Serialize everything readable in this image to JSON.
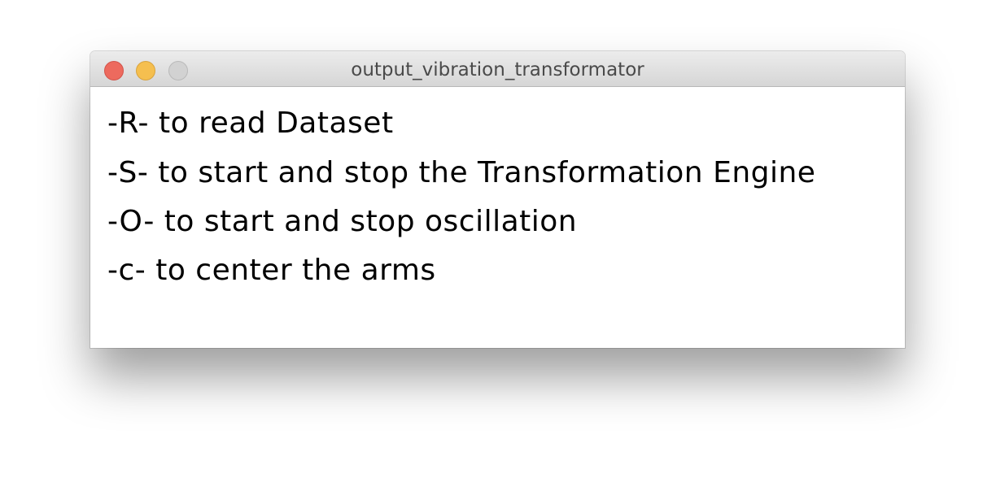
{
  "window": {
    "title": "output_vibration_transformator",
    "controls": {
      "close_color": "#ed6a5e",
      "minimize_color": "#f5bf4f",
      "zoom_color": "#d2d2d2"
    }
  },
  "content": {
    "lines": [
      "-R- to read Dataset",
      "-S- to start and stop the Transformation Engine",
      "-O- to start and stop oscillation",
      "-c- to center the arms"
    ]
  }
}
